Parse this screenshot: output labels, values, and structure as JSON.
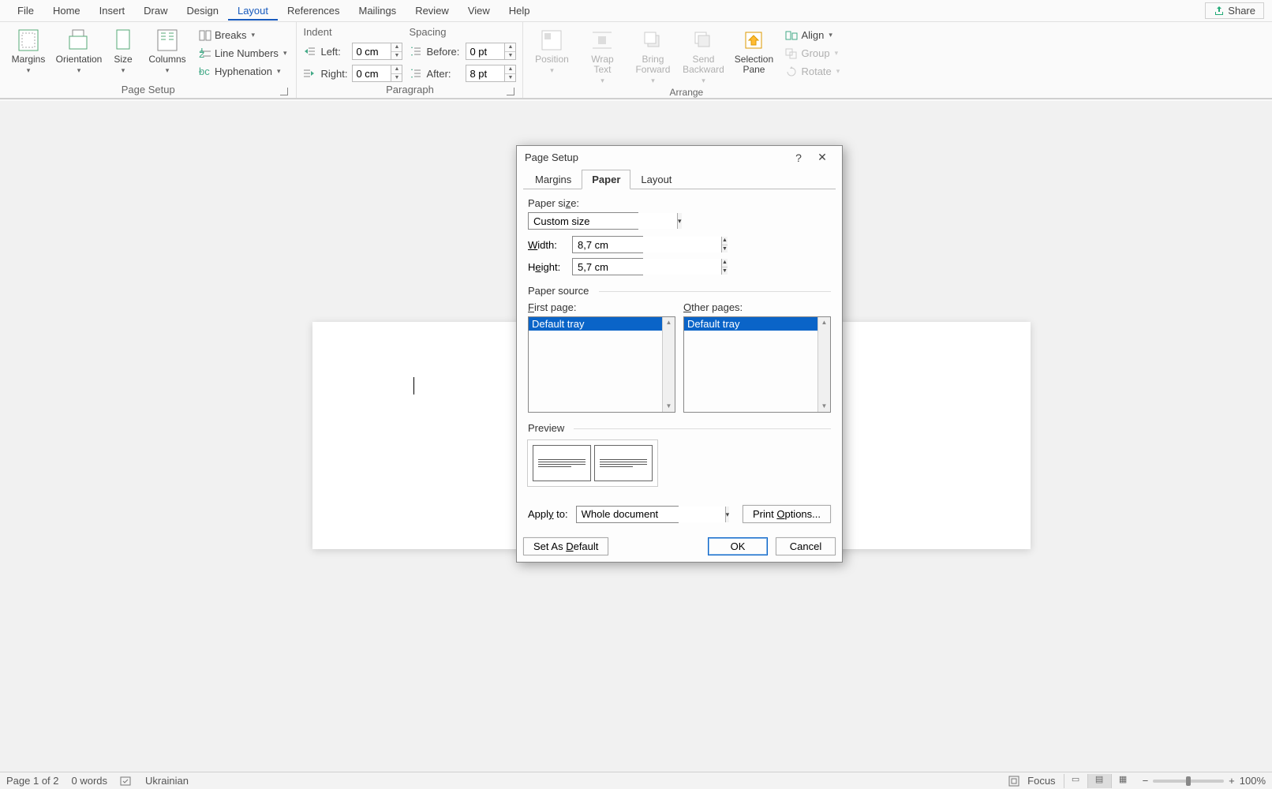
{
  "tabs": {
    "file": "File",
    "home": "Home",
    "insert": "Insert",
    "draw": "Draw",
    "design": "Design",
    "layout": "Layout",
    "references": "References",
    "mailings": "Mailings",
    "review": "Review",
    "view": "View",
    "help": "Help"
  },
  "share": "Share",
  "ribbon": {
    "page_setup": {
      "label": "Page Setup",
      "margins": "Margins",
      "orientation": "Orientation",
      "size": "Size",
      "columns": "Columns",
      "breaks": "Breaks",
      "line_numbers": "Line Numbers",
      "hyphenation": "Hyphenation"
    },
    "paragraph": {
      "label": "Paragraph",
      "indent": "Indent",
      "spacing": "Spacing",
      "left_label": "Left:",
      "right_label": "Right:",
      "before_label": "Before:",
      "after_label": "After:",
      "left_value": "0 cm",
      "right_value": "0 cm",
      "before_value": "0 pt",
      "after_value": "8 pt"
    },
    "arrange": {
      "label": "Arrange",
      "position": "Position",
      "wrap_text": "Wrap\nText",
      "bring_forward": "Bring\nForward",
      "send_backward": "Send\nBackward",
      "selection_pane": "Selection\nPane",
      "align": "Align",
      "group": "Group",
      "rotate": "Rotate"
    }
  },
  "dialog": {
    "title": "Page Setup",
    "tab_margins": "Margins",
    "tab_paper": "Paper",
    "tab_layout": "Layout",
    "paper_size_label": "Paper size:",
    "paper_size_value": "Custom size",
    "width_label": "Width:",
    "width_value": "8,7 cm",
    "height_label": "Height:",
    "height_value": "5,7 cm",
    "paper_source_label": "Paper source",
    "first_page_label": "First page:",
    "other_pages_label": "Other pages:",
    "tray_option": "Default tray",
    "preview_label": "Preview",
    "apply_to_label": "Apply to:",
    "apply_to_value": "Whole document",
    "print_options": "Print Options...",
    "set_default": "Set As Default",
    "ok": "OK",
    "cancel": "Cancel"
  },
  "status": {
    "page": "Page 1 of 2",
    "words": "0 words",
    "language": "Ukrainian",
    "focus": "Focus",
    "zoom": "100%"
  }
}
